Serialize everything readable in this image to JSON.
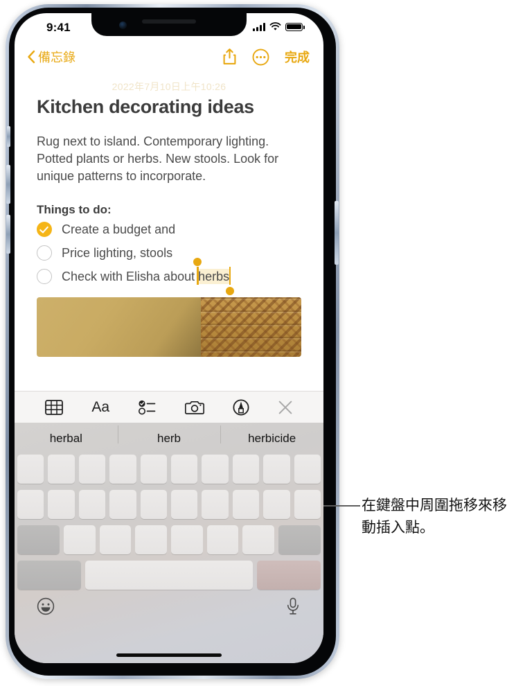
{
  "status_bar": {
    "time": "9:41",
    "signal_icon": "cellular-signal-icon",
    "wifi_icon": "wifi-icon",
    "battery_icon": "battery-full-icon"
  },
  "nav_bar": {
    "back_label": "備忘錄",
    "back_chevron": "chevron-left-icon",
    "share_icon": "share-icon",
    "more_icon": "more-circle-icon",
    "done_label": "完成"
  },
  "note": {
    "date": "2022年7月10日上午10:26",
    "title": "Kitchen decorating ideas",
    "paragraph": "Rug next to island. Contemporary lighting. Potted plants or herbs. New stools. Look for unique patterns to incorporate.",
    "todo_heading": "Things to do:",
    "todos": [
      {
        "checked": true,
        "text": "Create a budget and"
      },
      {
        "checked": false,
        "text": "Price lighting, stools"
      },
      {
        "checked": false,
        "text_before": "Check with Elisha about ",
        "selected_text": "herbs"
      }
    ],
    "attachment_name": "photo-attachment"
  },
  "format_toolbar": {
    "items": [
      {
        "name": "table-icon",
        "label": ""
      },
      {
        "name": "text-format-icon",
        "label": "Aa"
      },
      {
        "name": "checklist-icon",
        "label": ""
      },
      {
        "name": "camera-icon",
        "label": ""
      },
      {
        "name": "markup-pen-icon",
        "label": ""
      },
      {
        "name": "close-icon",
        "label": ""
      }
    ]
  },
  "keyboard": {
    "suggestions": [
      "herbal",
      "herb",
      "herbicide"
    ],
    "emoji_icon": "emoji-smiley-icon",
    "mic_icon": "microphone-icon",
    "row1_keys": 10,
    "row2_keys": 10,
    "row3_keys": 9,
    "row4_keys": 3,
    "keys_blank": true
  },
  "annotation": {
    "text": "在鍵盤中周圍拖移來移動插入點。"
  },
  "colors": {
    "accent": "#e8a811",
    "checkbox_filled": "#f5b517",
    "selection_highlight": "#fbf0d2",
    "text_primary": "#3b3b3b",
    "text_body": "#4a4a4a"
  }
}
